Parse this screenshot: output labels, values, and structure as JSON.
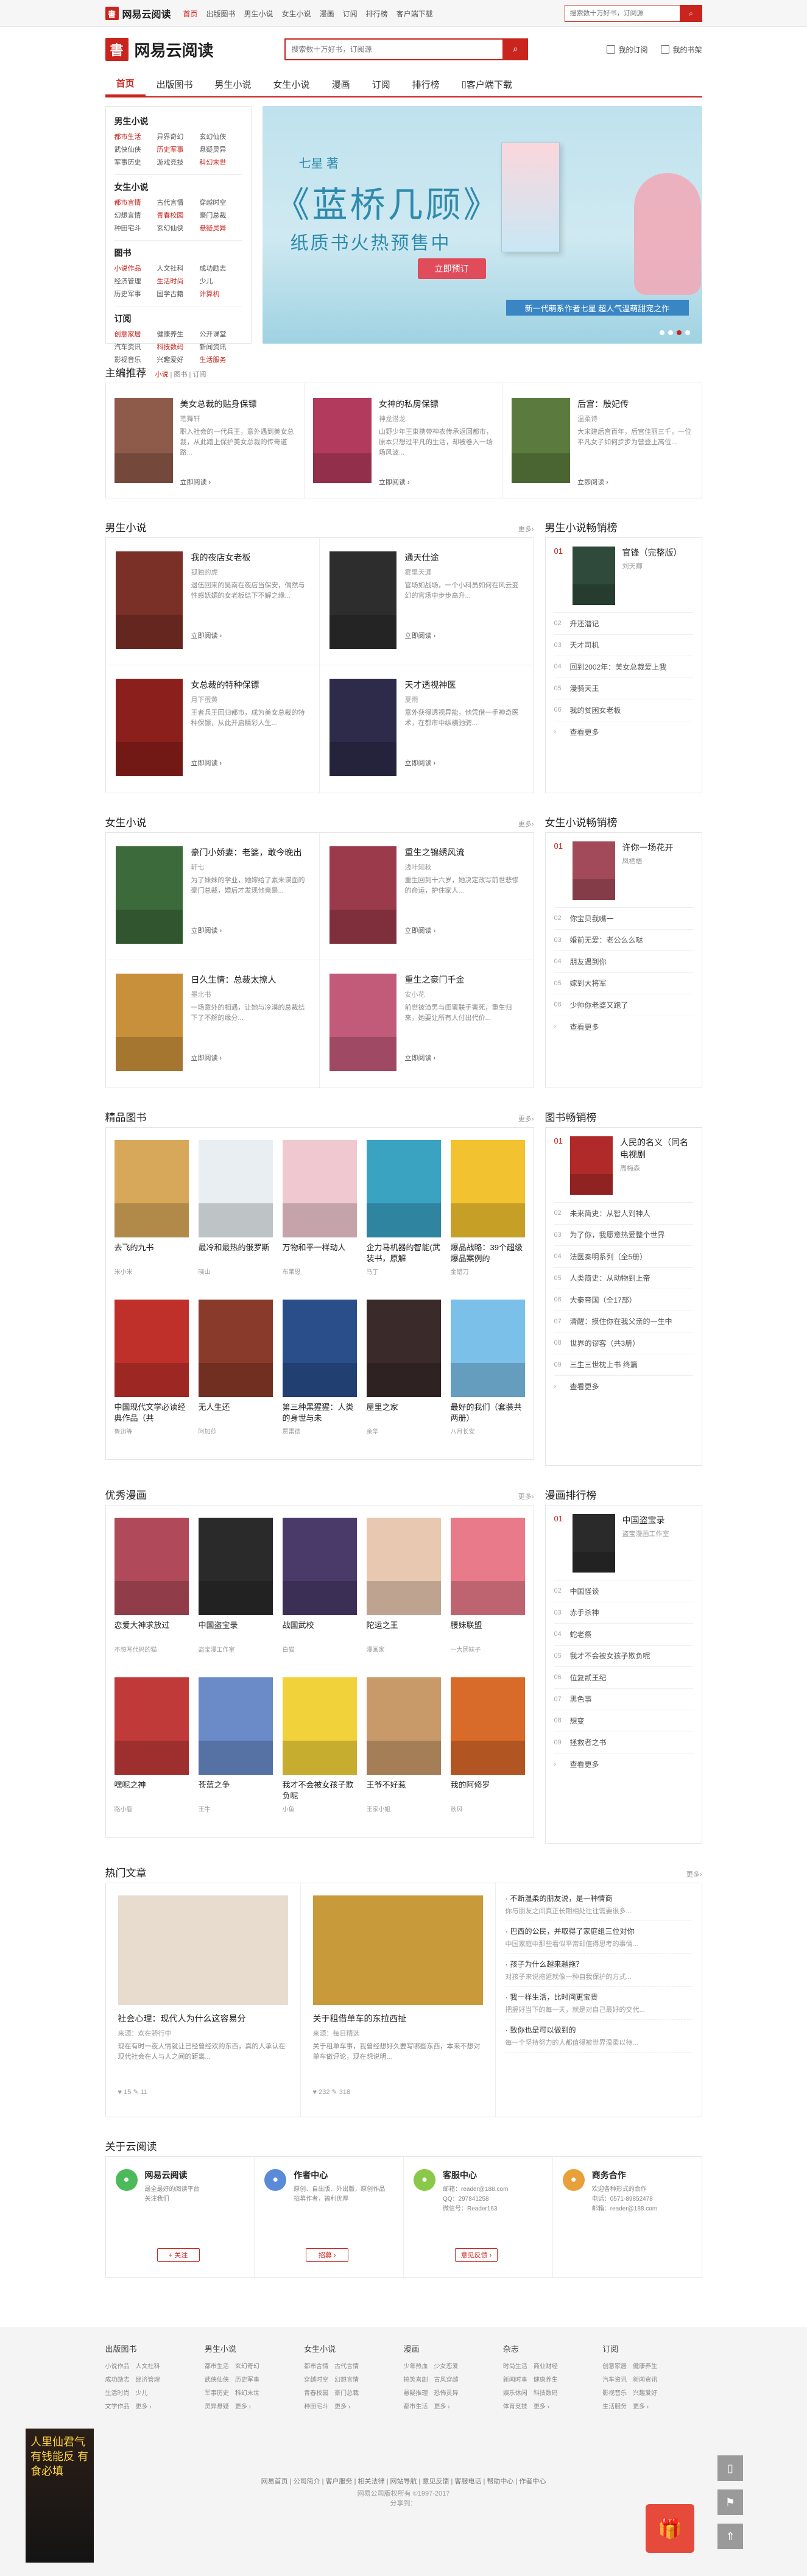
{
  "topbar": {
    "logo": "网易云阅读",
    "nav": [
      "首页",
      "出版图书",
      "男生小说",
      "女生小说",
      "漫画",
      "订阅",
      "排行榜",
      "客户端下载"
    ],
    "search_placeholder": "搜索数十万好书，订阅源"
  },
  "header": {
    "logo": "网易云阅读",
    "search_placeholder": "搜索数十万好书，订阅源",
    "my_subscribe": "我的订阅",
    "my_books": "我的书架"
  },
  "mainnav": [
    "首页",
    "出版图书",
    "男生小说",
    "女生小说",
    "漫画",
    "订阅",
    "排行榜",
    "客户端下载"
  ],
  "categories": [
    {
      "title": "男生小说",
      "items": [
        "都市生活",
        "异界奇幻",
        "玄幻仙侠",
        "武侠仙侠",
        "历史军事",
        "悬疑灵异",
        "军事历史",
        "游戏竞技",
        "科幻末世"
      ]
    },
    {
      "title": "女生小说",
      "items": [
        "都市言情",
        "古代言情",
        "穿越时空",
        "幻想言情",
        "青春校园",
        "豪门总裁",
        "种田宅斗",
        "玄幻仙侠",
        "悬疑灵异"
      ]
    },
    {
      "title": "图书",
      "items": [
        "小说作品",
        "人文社科",
        "成功励志",
        "经济管理",
        "生活时尚",
        "少儿",
        "历史军事",
        "国学古籍",
        "计算机"
      ]
    },
    {
      "title": "订阅",
      "items": [
        "创意家居",
        "健康养生",
        "公开课堂",
        "汽车资讯",
        "科技数码",
        "新闻资讯",
        "影视音乐",
        "兴趣爱好",
        "生活服务"
      ]
    }
  ],
  "banner": {
    "author": "七星 著",
    "title": "《蓝桥几顾》",
    "subtitle": "纸质书火热预售中",
    "button": "立即预订",
    "strip": "新一代萌系作者七星 超人气温萌甜宠之作"
  },
  "editor_pick": {
    "title": "主编推荐",
    "tabs": [
      "小说",
      "图书",
      "订阅"
    ],
    "items": [
      {
        "title": "美女总裁的贴身保镖",
        "author": "笔舞轩",
        "desc": "职入社会的一代兵王，意外遇到美女总裁，从此踏上保护美女总裁的传奇道路...",
        "link": "立即阅读 ›",
        "color": "#8e5a4a"
      },
      {
        "title": "女神的私房保镖",
        "author": "神龙潜龙",
        "desc": "山野少年王東携带神农传承返回都市，原本只想过平凡的生活，却被卷入一场场风波...",
        "link": "立即阅读 ›",
        "color": "#b23a5c"
      },
      {
        "title": "后宫：殷妃传",
        "author": "温柔诗",
        "desc": "大宋建后宫百年，后宫佳丽三千，一位平凡女子如何步步为营登上高位...",
        "link": "立即阅读 ›",
        "color": "#5b7a3e"
      }
    ]
  },
  "male": {
    "title": "男生小说",
    "more": "更多›",
    "items": [
      {
        "title": "我的夜店女老板",
        "author": "孤独的虎",
        "desc": "退伍回来的吴南在夜店当保安，偶然与性感妩媚的女老板结下不解之缘...",
        "link": "立即阅读 ›",
        "color": "#7a2f27"
      },
      {
        "title": "通天仕途",
        "author": "雾里天涯",
        "desc": "官场如战场，一个小科员如何在风云变幻的官场中步步高升...",
        "link": "立即阅读 ›",
        "color": "#2d2d2d"
      },
      {
        "title": "女总裁的特种保镖",
        "author": "月下蛋黄",
        "desc": "王者兵王回归都市，成为美女总裁的特种保镖，从此开启精彩人生...",
        "link": "立即阅读 ›",
        "color": "#8b1f1c"
      },
      {
        "title": "天才透视神医",
        "author": "夏雨",
        "desc": "意外获得透视异能，他凭借一手神奇医术，在都市中纵横驰骋...",
        "link": "立即阅读 ›",
        "color": "#2e2a4a"
      }
    ],
    "rank": {
      "title": "男生小说畅销榜",
      "top": {
        "num": "01",
        "title": "官锋（完整版）",
        "author": "刘天卿",
        "color": "#2f4a3a"
      },
      "list": [
        {
          "n": "02",
          "t": "升还潜记"
        },
        {
          "n": "03",
          "t": "天才司机"
        },
        {
          "n": "04",
          "t": "回到2002年：美女总裁爱上我"
        },
        {
          "n": "05",
          "t": "漫骑天王"
        },
        {
          "n": "06",
          "t": "我的贫困女老板"
        }
      ],
      "more": "查看更多"
    }
  },
  "female": {
    "title": "女生小说",
    "more": "更多›",
    "items": [
      {
        "title": "豪门小娇妻：老婆，敢今晚出",
        "author": "轩七",
        "desc": "为了妹妹的学业，她嫁给了素未谋面的豪门总裁，婚后才发现他竟是...",
        "link": "立即阅读 ›",
        "color": "#3c6a3a"
      },
      {
        "title": "重生之锦绣风流",
        "author": "浅叶知秋",
        "desc": "重生回到十六岁，她决定改写前世悲惨的命运，护住家人...",
        "link": "立即阅读 ›",
        "color": "#9b3a4a"
      },
      {
        "title": "日久生情：总裁太撩人",
        "author": "墨北书",
        "desc": "一场意外的相遇，让她与冷漠的总裁结下了不解的缘分...",
        "link": "立即阅读 ›",
        "color": "#c8903a"
      },
      {
        "title": "重生之豪门千金",
        "author": "安小花",
        "desc": "前世被渣男与闺蜜联手害死，重生归来，她要让所有人付出代价...",
        "link": "立即阅读 ›",
        "color": "#c25a7a"
      }
    ],
    "rank": {
      "title": "女生小说畅销榜",
      "top": {
        "num": "01",
        "title": "许你一场花开",
        "author": "凤栖梧",
        "color": "#a34a5a"
      },
      "list": [
        {
          "n": "02",
          "t": "你宝贝我嘴一"
        },
        {
          "n": "03",
          "t": "婚前无爱：老公么么哒"
        },
        {
          "n": "04",
          "t": "朋友遇到你"
        },
        {
          "n": "05",
          "t": "嫁到大将军"
        },
        {
          "n": "06",
          "t": "少帅你老婆又跑了"
        }
      ],
      "more": "查看更多"
    }
  },
  "books": {
    "title": "精品图书",
    "more": "更多›",
    "items": [
      {
        "title": "去飞的九书",
        "author": "米小米",
        "color": "#d8a85a"
      },
      {
        "title": "最冷和最热的俄罗斯",
        "author": "晓山",
        "color": "#e8eef2"
      },
      {
        "title": "万物和平一样动人",
        "author": "布莱恩",
        "color": "#f0c8d0"
      },
      {
        "title": "企力马机器的智能(武装书，原解",
        "author": "马丁",
        "color": "#3aa3c2"
      },
      {
        "title": "爆品战略：39个超级爆品案例的",
        "author": "金错刀",
        "color": "#f2c230"
      },
      {
        "title": "中国现代文学必读经典作品（共",
        "author": "鲁迅等",
        "color": "#c0302a"
      },
      {
        "title": "无人生还",
        "author": "阿加莎",
        "color": "#8a3a2a"
      },
      {
        "title": "第三种黑猩猩：人类的身世与未",
        "author": "贾雷德",
        "color": "#2a4e8a"
      },
      {
        "title": "屋里之家",
        "author": "余华",
        "color": "#3a2a2a"
      },
      {
        "title": "最好的我们（套装共两册）",
        "author": "八月长安",
        "color": "#7ac0e8"
      }
    ],
    "rank": {
      "title": "图书畅销榜",
      "top": {
        "num": "01",
        "title": "人民的名义（同名电视剧",
        "author": "周梅森",
        "color": "#b02a2a"
      },
      "list": [
        {
          "n": "02",
          "t": "未来简史：从智人到神人"
        },
        {
          "n": "03",
          "t": "为了你，我愿意热爱整个世界"
        },
        {
          "n": "04",
          "t": "法医秦明系列（全5册）"
        },
        {
          "n": "05",
          "t": "人类简史：从动物到上帝"
        },
        {
          "n": "06",
          "t": "大秦帝国（全17部）"
        },
        {
          "n": "07",
          "t": "清醒：摸住你在我父亲的一生中"
        },
        {
          "n": "08",
          "t": "世界的谬客（共3册）"
        },
        {
          "n": "09",
          "t": "三生三世枕上书 终篇"
        }
      ],
      "more": "查看更多"
    }
  },
  "comics": {
    "title": "优秀漫画",
    "more": "更多›",
    "items": [
      {
        "title": "恋爱大神求放过",
        "author": "不想写代码的猫",
        "color": "#b04a5a"
      },
      {
        "title": "中国盗宝录",
        "author": "盗宝漫工作室",
        "color": "#2a2a2a"
      },
      {
        "title": "战国武校",
        "author": "白猫",
        "color": "#4a3a6a"
      },
      {
        "title": "陀运之王",
        "author": "漫画家",
        "color": "#e8c8b0"
      },
      {
        "title": "腰妹联盟",
        "author": "一大团妹子",
        "color": "#e87a8a"
      },
      {
        "title": "嘿呢之神",
        "author": "路小鹿",
        "color": "#c03a3a"
      },
      {
        "title": "苍蓝之争",
        "author": "王牛",
        "color": "#6a8ac8"
      },
      {
        "title": "我才不会被女孩子欺负呢",
        "author": "小鱼",
        "color": "#f2d23a"
      },
      {
        "title": "王爷不好惹",
        "author": "王家小姐",
        "color": "#c89a6a"
      },
      {
        "title": "我的阿修罗",
        "author": "秋风",
        "color": "#d86a2a"
      }
    ],
    "rank": {
      "title": "漫画排行榜",
      "top": {
        "num": "01",
        "title": "中国盗宝录",
        "author": "盗宝漫画工作室",
        "color": "#2a2a2a"
      },
      "list": [
        {
          "n": "02",
          "t": "中国怪谈"
        },
        {
          "n": "03",
          "t": "赤手杀神"
        },
        {
          "n": "04",
          "t": "蛇老祭"
        },
        {
          "n": "05",
          "t": "我才不会被女孩子欺负呢"
        },
        {
          "n": "06",
          "t": "位复贰王纪"
        },
        {
          "n": "07",
          "t": "黑色事"
        },
        {
          "n": "08",
          "t": "想变"
        },
        {
          "n": "09",
          "t": "拯救者之书"
        }
      ],
      "more": "查看更多"
    }
  },
  "articles": {
    "title": "热门文章",
    "more": "更多›",
    "items": [
      {
        "title": "社会心理：现代人为什么这容易分",
        "author": "来源：欢在骄行中",
        "desc": "现在有时一夜人情就让已经曾经欢的东西，真的人承认在现代社会在人与人之间的距离...",
        "meta": "♥ 15   ✎ 11"
      },
      {
        "title": "关于租借单车的东拉西扯",
        "author": "来源：每日精选",
        "desc": "关于租单车事，我曾经想好久要写哪些东西，本来不想对单车做评论，现在想说明...",
        "meta": "♥ 232   ✎ 318"
      }
    ],
    "list": [
      {
        "t": "不断温柔的朋友说，是一种情商",
        "d": "你与朋友之间真正长期相处往往需要很多..."
      },
      {
        "t": "巴西的公民，并取得了家庭组三位对你",
        "d": "中国家庭中那些看似平常却值得思考的事情..."
      },
      {
        "t": "孩子为什么越来越拖？",
        "d": "对孩子来说拖延就像一种自我保护的方式..."
      },
      {
        "t": "我一样生活，比时间更宝贵",
        "d": "把握好当下的每一天，就是对自己最好的交代..."
      },
      {
        "t": "致你也是可以做到的",
        "d": "每一个坚持努力的人都值得被世界温柔以待..."
      }
    ]
  },
  "about": {
    "title": "关于云阅读",
    "items": [
      {
        "title": "网易云阅读",
        "lines": [
          "最全最好的阅读平台",
          "关注我们"
        ],
        "button": "+ 关注",
        "color": "#4cba5a",
        "icon": "wechat-icon"
      },
      {
        "title": "作者中心",
        "lines": [
          "原创、自出版、外出版，原创作品",
          "招募作者，福利优厚"
        ],
        "button": "招募 ›",
        "color": "#5a8ad8",
        "icon": "user-icon"
      },
      {
        "title": "客服中心",
        "lines": [
          "邮箱：reader@188.com",
          "QQ：297841258",
          "微信号：Reader163"
        ],
        "button": "意见反馈 ›",
        "color": "#8ac84a",
        "icon": "chat-icon"
      },
      {
        "title": "商务合作",
        "lines": [
          "欢迎各种形式的合作",
          "电话：0571-89852478",
          "邮箱：reader@188.com"
        ],
        "button": "",
        "color": "#e8a03a",
        "icon": "briefcase-icon"
      }
    ]
  },
  "footer": {
    "cols": [
      {
        "title": "出版图书",
        "rows": [
          [
            "小说作品",
            "人文社科"
          ],
          [
            "成功励志",
            "经济管理"
          ],
          [
            "生活时尚",
            "少儿"
          ],
          [
            "文学作品",
            "更多 ›"
          ]
        ]
      },
      {
        "title": "男生小说",
        "rows": [
          [
            "都市生活",
            "玄幻奇幻"
          ],
          [
            "武侠仙侠",
            "历史军事"
          ],
          [
            "军事历史",
            "科幻末世"
          ],
          [
            "灵异悬疑",
            "更多 ›"
          ]
        ]
      },
      {
        "title": "女生小说",
        "rows": [
          [
            "都市言情",
            "古代言情"
          ],
          [
            "穿越时空",
            "幻想言情"
          ],
          [
            "青春校园",
            "豪门总裁"
          ],
          [
            "种田宅斗",
            "更多 ›"
          ]
        ]
      },
      {
        "title": "漫画",
        "rows": [
          [
            "少年热血",
            "少女恋爱"
          ],
          [
            "搞笑喜剧",
            "古风穿越"
          ],
          [
            "悬疑推理",
            "恐怖灵异"
          ],
          [
            "都市生活",
            "更多 ›"
          ]
        ]
      },
      {
        "title": "杂志",
        "rows": [
          [
            "时尚生活",
            "商业财经"
          ],
          [
            "新闻时事",
            "健康养生"
          ],
          [
            "娱乐休闲",
            "科技数码"
          ],
          [
            "体育竞技",
            "更多 ›"
          ]
        ]
      },
      {
        "title": "订阅",
        "rows": [
          [
            "创意家居",
            "健康养生"
          ],
          [
            "汽车资讯",
            "新闻资讯"
          ],
          [
            "影视音乐",
            "兴趣爱好"
          ],
          [
            "生活服务",
            "更多 ›"
          ]
        ]
      }
    ],
    "links": "网易首页 | 公司简介 | 客户服务 | 相关法律 | 网站导航 | 意见反馈 | 客服电话 | 帮助中心 | 作者中心",
    "copy1": "网易公司版权所有 ©1997-2017",
    "copy2": "分享到："
  },
  "leftad": {
    "text": "人里仙君气 有钱能反 有食必填"
  }
}
